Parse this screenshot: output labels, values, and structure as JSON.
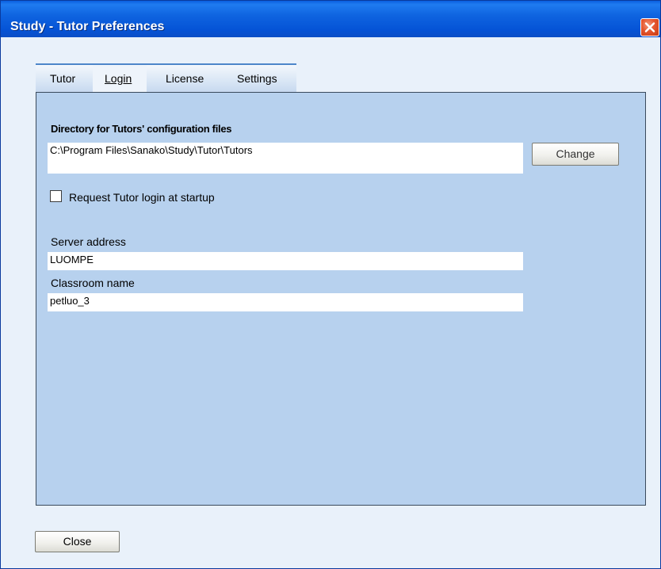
{
  "window": {
    "title": "Study - Tutor Preferences"
  },
  "tabs": [
    {
      "label": "Tutor",
      "active": false
    },
    {
      "label": "Login",
      "active": true
    },
    {
      "label": "License",
      "active": false
    },
    {
      "label": "Settings",
      "active": false
    }
  ],
  "login": {
    "directory_heading": "Directory for Tutors' configuration files",
    "directory_value": "C:\\Program Files\\Sanako\\Study\\Tutor\\Tutors",
    "change_label": "Change",
    "request_login_label": "Request Tutor login at startup",
    "request_login_checked": false,
    "server_label": "Server address",
    "server_value": "LUOMPE",
    "classroom_label": "Classroom name",
    "classroom_value": "petluo_3"
  },
  "footer": {
    "close_label": "Close"
  },
  "icons": {
    "close": "close-x-icon"
  },
  "colors": {
    "titlebar": "#0553d6",
    "close_button": "#e5552d",
    "panel": "#b7d1ee",
    "window_bg": "#e9f1fa"
  }
}
